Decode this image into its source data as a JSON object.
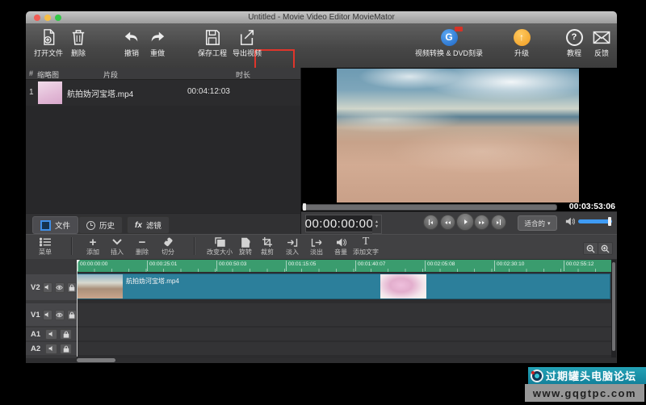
{
  "window": {
    "title": "Untitled - Movie Video Editor MovieMator"
  },
  "toolbar": {
    "open_file": "打开文件",
    "delete": "删除",
    "undo": "撤销",
    "redo": "重做",
    "save_project": "保存工程",
    "export_video": "导出视频",
    "convert_dvd": "视频转换 & DVD刻录",
    "upgrade": "升级",
    "tutorial": "教程",
    "feedback": "反馈"
  },
  "file_panel": {
    "col_index": "#",
    "col_thumb": "缩略图",
    "col_clip": "片段",
    "col_duration": "时长",
    "row": {
      "index": "1",
      "name": "航拍妫河宝塔.mp4",
      "duration": "00:04:12:03"
    },
    "tab_files": "文件",
    "tab_history": "历史",
    "tab_fx": "fx",
    "tab_filters": "滤镜"
  },
  "preview": {
    "total_time": "00:03:53:06",
    "current_time": "00:00:00:00",
    "zoom_mode": "适合的",
    "dropdown_arrow": "▾"
  },
  "timeline_toolbar": {
    "menu": "菜单",
    "add": "添加",
    "insert": "插入",
    "remove": "删除",
    "split": "切分",
    "resize": "改变大小",
    "rotate": "旋转",
    "crop": "裁剪",
    "fade_in": "淡入",
    "fade_out": "淡出",
    "volume": "音量",
    "add_text": "添加文字",
    "add_glyph": "+",
    "remove_glyph": "−",
    "text_glyph": "T",
    "fx_glyph": "fx"
  },
  "timeline": {
    "ticks": [
      "00:00:00:00",
      "00:00:25:01",
      "00:00:50:03",
      "00:01:15:05",
      "00:01:40:07",
      "00:02:05:08",
      "00:02:30:10",
      "00:02:55:12"
    ],
    "track_v2": "V2",
    "track_v1": "V1",
    "track_a1": "A1",
    "track_a2": "A2",
    "clip_name": "航拍妫河宝塔.mp4"
  },
  "watermark": {
    "title": "过期罐头电脑论坛",
    "url": "www.gqgtpc.com"
  },
  "colors": {
    "export_highlight": "#e0352b",
    "ruler_green": "#3a9c6e",
    "clip_teal": "#2c7f9b",
    "volume_blue": "#3f9bf4",
    "watermark_teal": "#1b96aa",
    "upgrade_orange": "#f0a33a",
    "convert_blue": "#2a7de1"
  }
}
